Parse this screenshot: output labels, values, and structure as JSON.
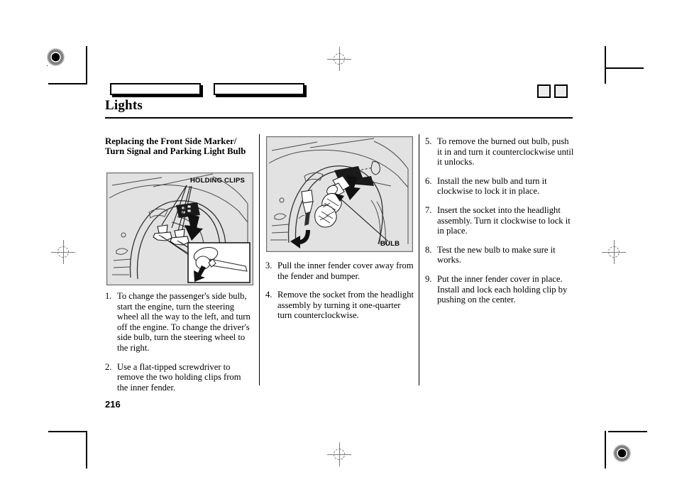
{
  "page": {
    "section_title": "Lights",
    "page_number": "216"
  },
  "header": {
    "tab_left_label": "",
    "tab_right_label": "",
    "corner_box_1_label": "",
    "corner_box_2_label": ""
  },
  "columns": {
    "left": {
      "sub_heading": "Replacing the Front Side Marker/ Turn Signal and Parking Light Bulb",
      "figure": {
        "label": "HOLDING CLIPS",
        "caption": ""
      },
      "steps": [
        {
          "num": "1.",
          "text": "To change the passenger's side bulb, start the engine, turn the steering wheel all the way to the left, and turn off the engine. To change the driver's side bulb, turn the steering wheel to the right."
        },
        {
          "num": "2.",
          "text": "Use a flat-tipped screwdriver to remove the two holding clips from the inner fender."
        }
      ]
    },
    "middle": {
      "figure": {
        "label": "BULB",
        "caption": ""
      },
      "steps": [
        {
          "num": "3.",
          "text": "Pull the inner fender cover away from the fender and bumper."
        },
        {
          "num": "4.",
          "text": "Remove the socket from the headlight assembly by turning it one-quarter turn counterclockwise."
        }
      ]
    },
    "right": {
      "steps": [
        {
          "num": "5.",
          "text": "To remove the burned out bulb, push it in and turn it counterclockwise until it unlocks."
        },
        {
          "num": "6.",
          "text": "Install the new bulb and turn it clockwise to lock it in place."
        },
        {
          "num": "7.",
          "text": "Insert the socket into the headlight assembly. Turn it clockwise to lock it in place."
        },
        {
          "num": "8.",
          "text": "Test the new bulb to make sure it works."
        },
        {
          "num": "9.",
          "text": "Put the inner fender cover in place. Install and lock each holding clip by pushing on the center."
        }
      ]
    }
  },
  "colors": {
    "figure_background": "#e2e2e2",
    "rule": "#000000",
    "registration_mark": "#7a7a7a"
  }
}
